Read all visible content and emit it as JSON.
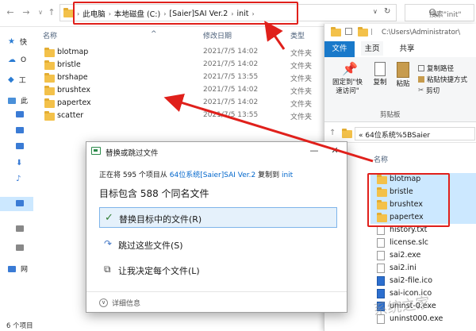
{
  "address": {
    "crumbs": [
      "此电脑",
      "本地磁盘 (C:)",
      "[Saier]SAI Ver.2",
      "init"
    ],
    "search_placeholder": "搜索\"init\""
  },
  "columns": {
    "name": "名称",
    "date": "修改日期",
    "type": "类型"
  },
  "files": [
    {
      "name": "blotmap",
      "date": "2021/7/5 14:02",
      "type": "文件夹"
    },
    {
      "name": "bristle",
      "date": "2021/7/5 14:02",
      "type": "文件夹"
    },
    {
      "name": "brshape",
      "date": "2021/7/5 13:55",
      "type": "文件夹"
    },
    {
      "name": "brushtex",
      "date": "2021/7/5 14:02",
      "type": "文件夹"
    },
    {
      "name": "papertex",
      "date": "2021/7/5 14:02",
      "type": "文件夹"
    },
    {
      "name": "scatter",
      "date": "2021/7/5 13:55",
      "type": "文件夹"
    }
  ],
  "side_nav": [
    {
      "label": "快",
      "icon": "star-icon",
      "color": "#2b7cd3"
    },
    {
      "label": "O",
      "icon": "cloud-icon",
      "color": "#2b7cd3"
    },
    {
      "label": "工",
      "icon": "diamond-icon",
      "color": "#2b7cd3"
    },
    {
      "label": "此",
      "icon": "computer-icon",
      "color": "#4a90d9"
    },
    {
      "label": "",
      "icon": "video-icon",
      "color": "#3a7bd5"
    },
    {
      "label": "",
      "icon": "picture-icon",
      "color": "#3a7bd5"
    },
    {
      "label": "",
      "icon": "document-icon",
      "color": "#3a7bd5"
    },
    {
      "label": "",
      "icon": "download-icon",
      "color": "#3a7bd5"
    },
    {
      "label": "",
      "icon": "music-icon",
      "color": "#3a7bd5"
    },
    {
      "label": "",
      "icon": "desktop-icon",
      "color": "#3a7bd5"
    },
    {
      "label": "",
      "icon": "drive-icon",
      "color": "#666666"
    },
    {
      "label": "",
      "icon": "drive-icon",
      "color": "#666666"
    },
    {
      "label": "网",
      "icon": "network-icon",
      "color": "#3a7bd5"
    }
  ],
  "status_left": "6 个项目",
  "right": {
    "path": "C:\\Users\\Administrator\\",
    "tabs": [
      "文件",
      "主页",
      "共享"
    ],
    "ribbon": {
      "pin": "固定到\"快\n速访问\"",
      "copy": "复制",
      "paste": "粘贴",
      "copy_path": "复制路径",
      "paste_shortcut": "粘贴快捷方式",
      "cut": "剪切",
      "group": "剪贴板"
    },
    "address": "« 64位系统%5BSaier",
    "list_header": "名称",
    "items": [
      {
        "name": "blotmap",
        "kind": "folder",
        "selected": true
      },
      {
        "name": "bristle",
        "kind": "folder",
        "selected": true
      },
      {
        "name": "brushtex",
        "kind": "folder",
        "selected": true
      },
      {
        "name": "papertex",
        "kind": "folder",
        "selected": true
      },
      {
        "name": "history.txt",
        "kind": "file",
        "selected": false
      },
      {
        "name": "license.slc",
        "kind": "file",
        "selected": false
      },
      {
        "name": "sai2.exe",
        "kind": "file",
        "selected": false
      },
      {
        "name": "sai2.ini",
        "kind": "file",
        "selected": false
      },
      {
        "name": "sai2-file.ico",
        "kind": "icon",
        "selected": false
      },
      {
        "name": "sai-icon.ico",
        "kind": "icon",
        "selected": false
      },
      {
        "name": "uninst-0.exe",
        "kind": "icon",
        "selected": false
      },
      {
        "name": "uninst000.exe",
        "kind": "file",
        "selected": false
      }
    ]
  },
  "dialog": {
    "title": "替换或跳过文件",
    "copy_prefix": "正在将 595 个项目从 ",
    "copy_source": "64位系统[Saier]SAI Ver.2",
    "copy_mid": " 复制到 ",
    "copy_dest": "init",
    "contains": "目标包含 588 个同名文件",
    "options": [
      {
        "label": "替换目标中的文件(R)",
        "mark": "✓",
        "selected": true
      },
      {
        "label": "跳过这些文件(S)",
        "mark": "↷",
        "selected": false
      },
      {
        "label": "让我决定每个文件(L)",
        "mark": "⧉",
        "selected": false
      }
    ],
    "details": "详细信息"
  },
  "watermark": "系统之家"
}
